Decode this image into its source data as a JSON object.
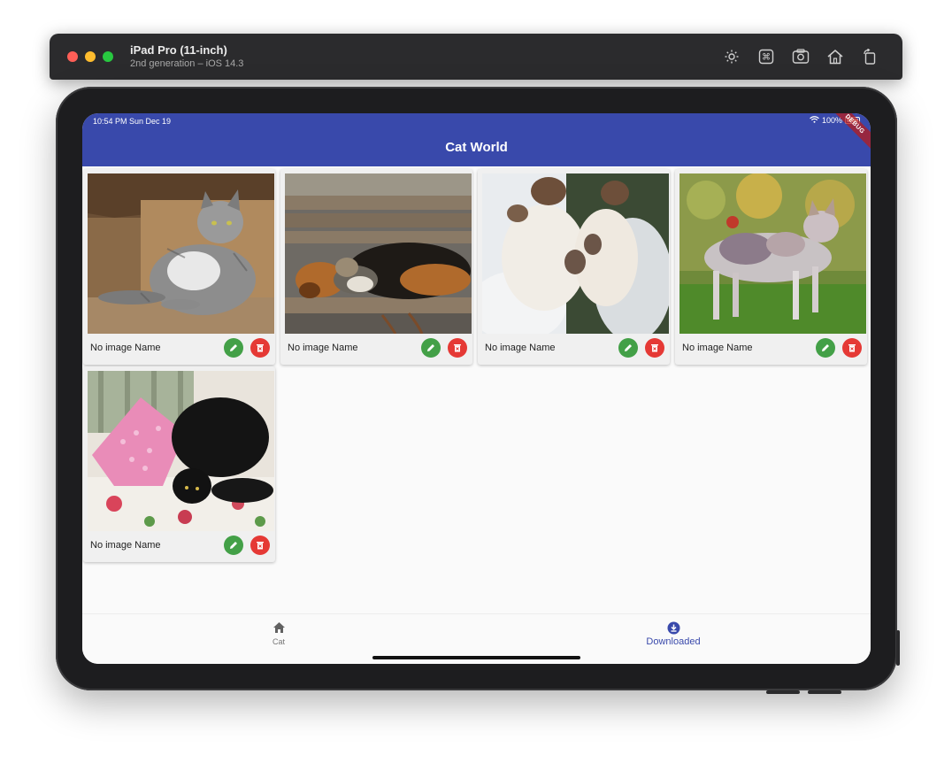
{
  "simulator": {
    "device_name": "iPad Pro (11-inch)",
    "device_subtitle": "2nd generation – iOS 14.3",
    "tools": [
      "brightness-icon",
      "command-icon",
      "screenshot-icon",
      "home-icon",
      "rotate-icon"
    ]
  },
  "status_bar": {
    "time_date": "10:54 PM   Sun Dec 19",
    "battery": "100%"
  },
  "app_bar": {
    "title": "Cat World",
    "debug_banner": "DEBUG",
    "color": "#3949ab"
  },
  "cards": [
    {
      "name": "No image Name",
      "image": "tabby cat in cardboard box"
    },
    {
      "name": "No image Name",
      "image": "dog and cat sleeping on bench"
    },
    {
      "name": "No image Name",
      "image": "two fluffy white cats in snow"
    },
    {
      "name": "No image Name",
      "image": "calico cat standing on grass"
    },
    {
      "name": "No image Name",
      "image": "black cat lying on pink pillow"
    }
  ],
  "card_actions": {
    "edit_color": "#43a047",
    "delete_color": "#e53935"
  },
  "bottom_nav": {
    "items": [
      {
        "label": "Cat",
        "icon": "home-icon",
        "selected": false
      },
      {
        "label": "Downloaded",
        "icon": "download-circle-icon",
        "selected": true
      }
    ]
  }
}
